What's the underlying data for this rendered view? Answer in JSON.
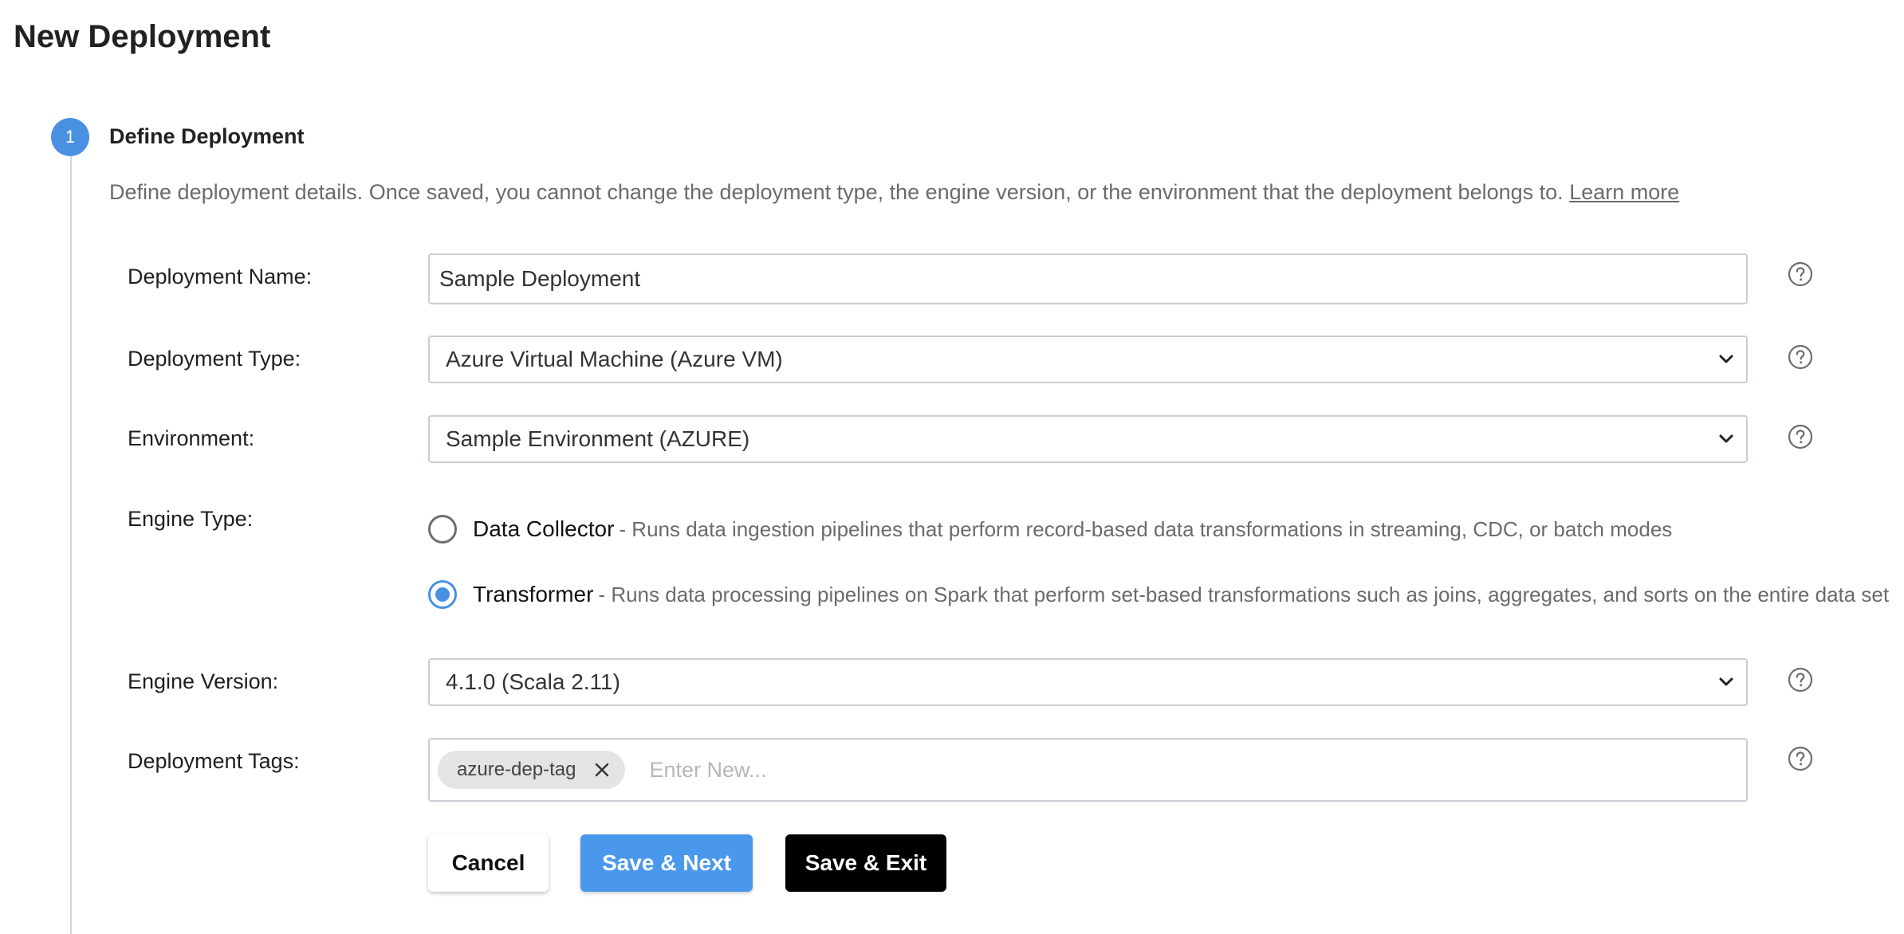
{
  "page": {
    "title": "New Deployment"
  },
  "step": {
    "number": "1",
    "title": "Define Deployment",
    "description": "Define deployment details. Once saved, you cannot change the deployment type, the engine version, or the environment that the deployment belongs to.",
    "learn_more": "Learn more"
  },
  "form": {
    "deployment_name": {
      "label": "Deployment Name:",
      "value": "Sample Deployment"
    },
    "deployment_type": {
      "label": "Deployment Type:",
      "value": "Azure Virtual Machine (Azure VM)"
    },
    "environment": {
      "label": "Environment:",
      "value": "Sample Environment (AZURE)"
    },
    "engine_type": {
      "label": "Engine Type:",
      "options": [
        {
          "label": "Data Collector",
          "description": "- Runs data ingestion pipelines that perform record-based data transformations in streaming, CDC, or batch modes",
          "checked": false
        },
        {
          "label": "Transformer",
          "description": "- Runs data processing pipelines on Spark that perform set-based transformations such as joins, aggregates, and sorts on the entire data set",
          "checked": true
        }
      ]
    },
    "engine_version": {
      "label": "Engine Version:",
      "value": "4.1.0 (Scala 2.11)"
    },
    "deployment_tags": {
      "label": "Deployment Tags:",
      "tags": [
        "azure-dep-tag"
      ],
      "placeholder": "Enter New..."
    }
  },
  "buttons": {
    "cancel": "Cancel",
    "save_next": "Save & Next",
    "save_exit": "Save & Exit"
  },
  "colors": {
    "accent": "#4a90e2",
    "save_next_bg": "#4a98ec",
    "save_exit_bg": "#000000",
    "muted_text": "#6b6b6b"
  },
  "icons": {
    "help": "question-circle-icon",
    "dropdown": "chevron-down-icon",
    "remove_tag": "close-icon"
  }
}
